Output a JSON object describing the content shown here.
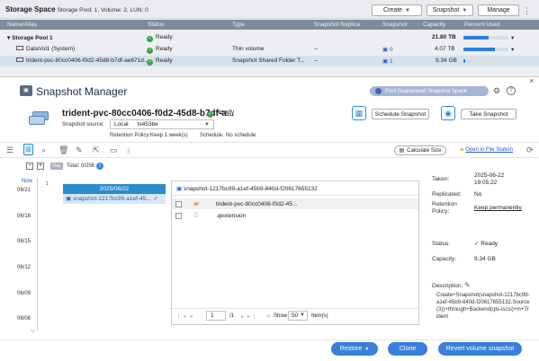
{
  "app": {
    "title": "Storage Space",
    "subtitle": "Storage Pool: 1, Volume: 2, LUN: 0",
    "buttons": {
      "create": "Create",
      "snapshot": "Snapshot",
      "manage": "Manage"
    },
    "columns": [
      "Name/Alias",
      "Status",
      "Type",
      "Snapshot Replica",
      "Snapshot",
      "Capacity",
      "Percent Used"
    ],
    "rows": [
      {
        "name": "Storage Pool 1",
        "status": "Ready",
        "type": "",
        "replica": "",
        "snapshot": "",
        "capacity": "21.80 TB",
        "percent": 0.55
      },
      {
        "name": "DataVol1 (System)",
        "status": "Ready",
        "type": "Thin volume",
        "replica": "--",
        "snapshot": "0",
        "capacity": "4.07 TB",
        "percent": 0.7
      },
      {
        "name": "trident-pvc-80cc0406-f0d2-45d8-b7df-ae671d...",
        "status": "Ready",
        "type": "Snapshot Shared Folder T...",
        "replica": "--",
        "snapshot": "1",
        "capacity": "9.34 GB",
        "percent": 0.03
      }
    ]
  },
  "dialog": {
    "title": "Snapshot Manager",
    "pool_badge": "Pool Guaranteed Snapshot Space",
    "volume_name": "trident-pvc-80cc0406-f0d2-45d8-b7df-a...",
    "volume_status": "Ready",
    "source_label": "Snapshot source:",
    "source_scope": "Local",
    "source_host": "ts453be",
    "retention_label": "Retention Policy:",
    "retention_value": "Keep 1 week(s)",
    "schedule_label": "Schedule:",
    "schedule_value": "No schedule",
    "schedule_button": "Schedule Snapshot",
    "take_button": "Take Snapshot",
    "calc_button": "Calculate Size",
    "open_link": "Open in File Station",
    "timeline": {
      "day_badge": "Day",
      "total": "Total: 0/256",
      "now": "Now",
      "n1": "1",
      "dates": [
        "06/21",
        "06/18",
        "06/15",
        "06/12",
        "06/09",
        "06/06"
      ],
      "group_date": "2025/06/22",
      "snapshot_item": "snapshot-1217bc99-a1ef-45..."
    },
    "browser": {
      "path": "snapshot-1217bc99-a1ef-45b9-840d-f2061765513​2",
      "files": [
        "trident-pvc-80cc0406-f0d2-45...",
        ".qextension"
      ],
      "page": "1",
      "page_total": "/1",
      "show_label": "Show",
      "show_value": "50",
      "items_label": "Item(s)"
    },
    "props": {
      "taken_label": "Taken:",
      "taken_value": "2025-06-22 19:05:22",
      "replicated_label": "Replicated:",
      "replicated_value": "No",
      "retention_label": "Retention Policy:",
      "retention_value": "Keep permanently",
      "status_label": "Status:",
      "status_value": "Ready",
      "capacity_label": "Capacity:",
      "capacity_value": "9.34 GB",
      "description_label": "Description:",
      "description_value": "Create+Snapshot(snapshot-1217bc99-a1ef-45b9-840d-f2061765513​2,Source(3))+through+Backend(qts-iscsi)+in+Trident"
    },
    "footer": {
      "restore": "Restore",
      "clone": "Clone",
      "revert": "Revert volume snapshot"
    }
  }
}
